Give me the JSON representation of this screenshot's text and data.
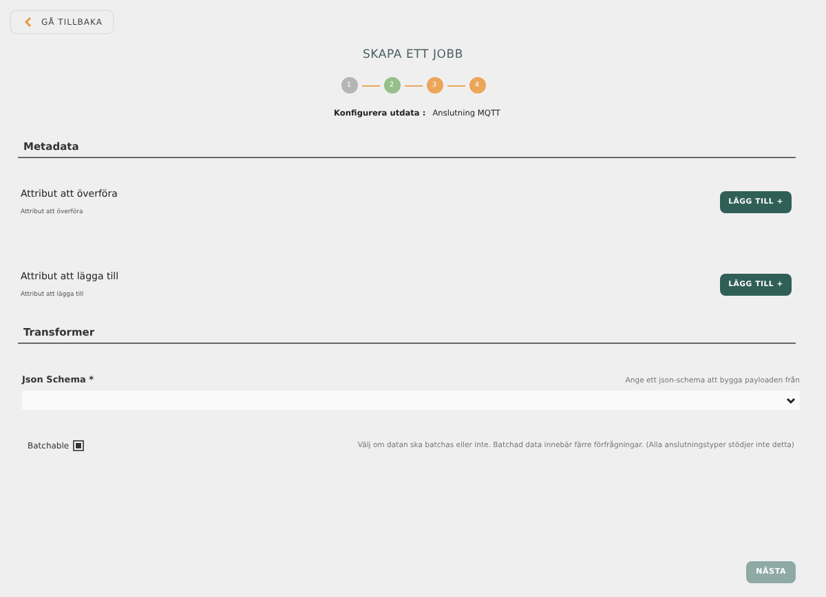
{
  "back_button": {
    "label": "GÅ TILLBAKA"
  },
  "title": "SKAPA ETT JOBB",
  "steps": [
    {
      "label": "1",
      "color": "#b5b5b5"
    },
    {
      "label": "2",
      "color": "#97bf8c"
    },
    {
      "label": "3",
      "color": "#eba659"
    },
    {
      "label": "4",
      "color": "#eba659"
    }
  ],
  "config": {
    "label": "Konfigurera utdata :",
    "value": "Anslutning MQTT"
  },
  "metadata": {
    "heading": "Metadata",
    "attributes": [
      {
        "title": "Attribut att överföra",
        "subtitle": "Attribut att överföra",
        "button": "LÄGG TILL +"
      },
      {
        "title": "Attribut att lägga till",
        "subtitle": "Attribut att lägga till",
        "button": "LÄGG TILL +"
      }
    ]
  },
  "transformer": {
    "heading": "Transformer",
    "json_schema": {
      "label": "Json Schema *",
      "hint": "Ange ett json-schema att bygga payloaden från"
    },
    "batchable": {
      "label": "Batchable",
      "checked": true,
      "hint": "Välj om datan ska batchas eller inte. Batchad data innebär färre förfrågningar. (Alla anslutningstyper stödjer inte detta)"
    }
  },
  "next_button": {
    "label": "NÄSTA",
    "disabled": true
  }
}
